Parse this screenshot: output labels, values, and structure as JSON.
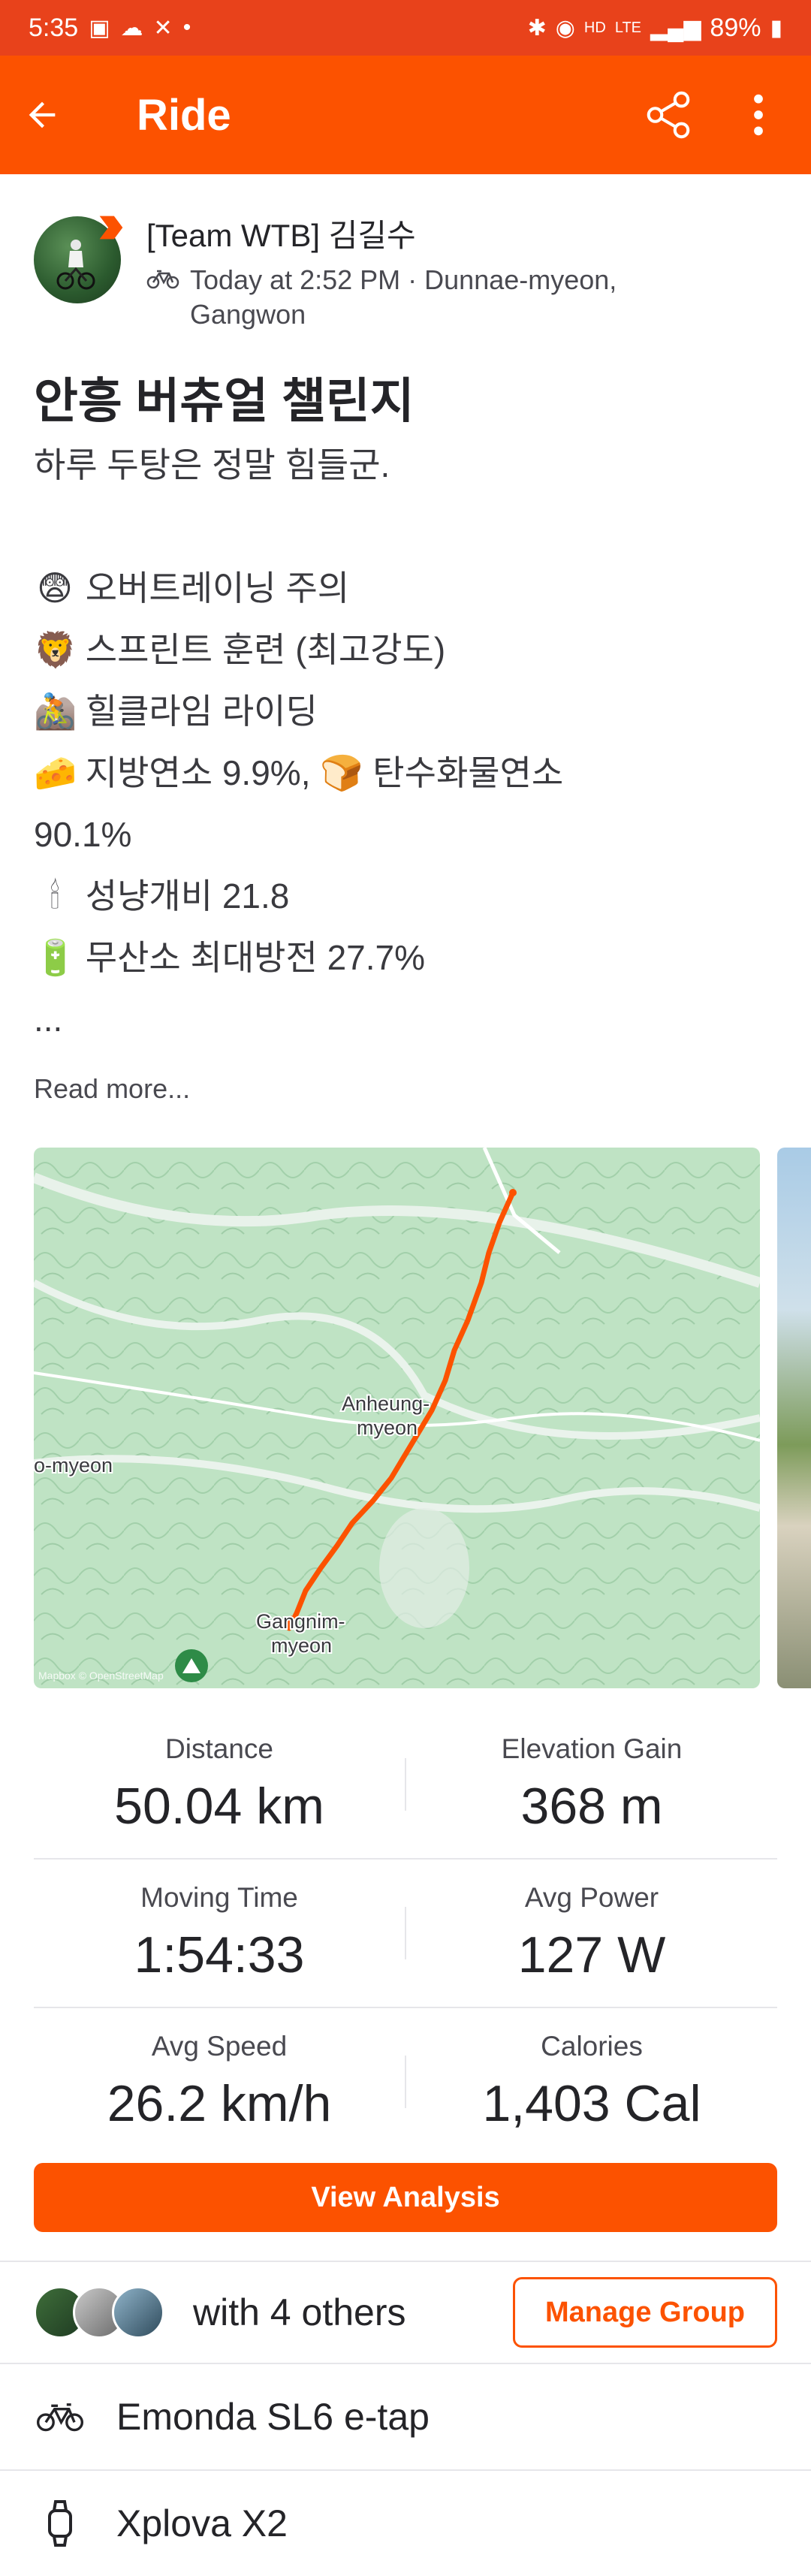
{
  "status_bar": {
    "time": "5:35",
    "battery": "89%"
  },
  "app_bar": {
    "title": "Ride"
  },
  "athlete": {
    "name": "[Team WTB] 김길수",
    "meta_line1": "Today at 2:52 PM · Dunnae-myeon,",
    "meta_line2": "Gangwon"
  },
  "activity": {
    "title": "안흥 버츄얼 챌린지",
    "description": [
      {
        "emoji": "",
        "text": "하루 두탕은 정말 힘들군."
      },
      {
        "emoji": "",
        "text": ""
      },
      {
        "emoji": "😨",
        "text": "오버트레이닝 주의"
      },
      {
        "emoji": "🦁",
        "text": "스프린트 훈련 (최고강도)"
      },
      {
        "emoji": "🚵",
        "text": "힐클라임 라이딩"
      },
      {
        "emoji": "🧀",
        "text": "지방연소 9.9%, 🍞 탄수화물연소"
      },
      {
        "emoji": "",
        "text": "90.1%"
      },
      {
        "emoji": "🕯",
        "text": "성냥개비 21.8"
      },
      {
        "emoji": "🔋",
        "text": "무산소 최대방전 27.7%"
      },
      {
        "emoji": "",
        "text": "..."
      }
    ],
    "read_more": "Read more..."
  },
  "map": {
    "labels": [
      "Anheung-",
      "myeon",
      "o-myeon",
      "Gangnim-",
      "myeon"
    ],
    "attribution": "Mapbox © OpenStreetMap",
    "route_color": "#fc5200"
  },
  "stats": [
    {
      "label": "Distance",
      "value": "50.04 km"
    },
    {
      "label": "Elevation Gain",
      "value": "368 m"
    },
    {
      "label": "Moving Time",
      "value": "1:54:33"
    },
    {
      "label": "Avg Power",
      "value": "127 W"
    },
    {
      "label": "Avg Speed",
      "value": "26.2 km/h"
    },
    {
      "label": "Calories",
      "value": "1,403 Cal"
    }
  ],
  "analysis_button": "View Analysis",
  "group": {
    "text": "with 4 others",
    "button": "Manage Group"
  },
  "gear": [
    {
      "icon": "bike-icon",
      "name": "Emonda SL6 e-tap"
    },
    {
      "icon": "watch-icon",
      "name": "Xplova X2"
    }
  ],
  "colors": {
    "brand": "#fc5200",
    "status_bar": "#e8421b"
  }
}
